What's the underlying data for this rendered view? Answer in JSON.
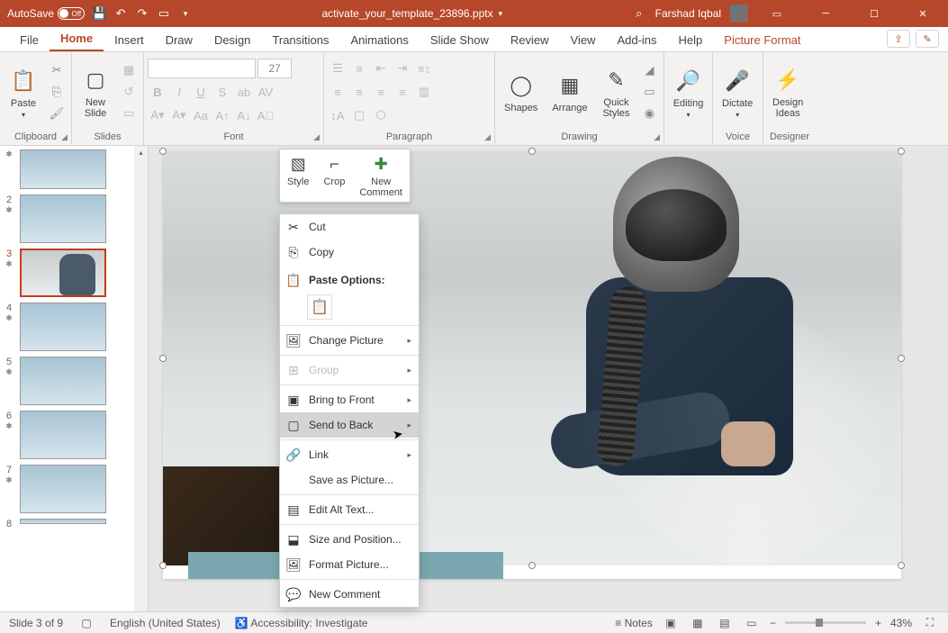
{
  "titlebar": {
    "autosave_label": "AutoSave",
    "autosave_state": "Off",
    "filename": "activate_your_template_23896.pptx",
    "username": "Farshad Iqbal",
    "search_icon": "⌕"
  },
  "tabs": {
    "file": "File",
    "home": "Home",
    "insert": "Insert",
    "draw": "Draw",
    "design": "Design",
    "transitions": "Transitions",
    "animations": "Animations",
    "slideshow": "Slide Show",
    "review": "Review",
    "view": "View",
    "addins": "Add-ins",
    "help": "Help",
    "picture_format": "Picture Format"
  },
  "ribbon": {
    "clipboard": {
      "label": "Clipboard",
      "paste": "Paste"
    },
    "slides": {
      "label": "Slides",
      "new_slide": "New\nSlide"
    },
    "font": {
      "label": "Font",
      "size": "27"
    },
    "paragraph": {
      "label": "Paragraph"
    },
    "drawing": {
      "label": "Drawing",
      "shapes": "Shapes",
      "arrange": "Arrange",
      "quick_styles": "Quick\nStyles"
    },
    "editing": {
      "label": "Editing"
    },
    "voice": {
      "label": "Voice",
      "dictate": "Dictate"
    },
    "designer": {
      "label": "Designer",
      "ideas": "Design\nIdeas"
    }
  },
  "mini_toolbar": {
    "style": "Style",
    "crop": "Crop",
    "new_comment": "New\nComment"
  },
  "context_menu": {
    "cut": "Cut",
    "copy": "Copy",
    "paste_options": "Paste Options:",
    "change_picture": "Change Picture",
    "group": "Group",
    "bring_to_front": "Bring to Front",
    "send_to_back": "Send to Back",
    "link": "Link",
    "save_as_picture": "Save as Picture...",
    "edit_alt_text": "Edit Alt Text...",
    "size_and_position": "Size and Position...",
    "format_picture": "Format Picture...",
    "new_comment": "New Comment"
  },
  "thumbs": {
    "nums": [
      "2",
      "3",
      "4",
      "5",
      "6",
      "7",
      "8"
    ]
  },
  "statusbar": {
    "slide_info": "Slide 3 of 9",
    "language": "English (United States)",
    "accessibility": "Accessibility: Investigate",
    "notes": "Notes",
    "zoom": "43%"
  }
}
